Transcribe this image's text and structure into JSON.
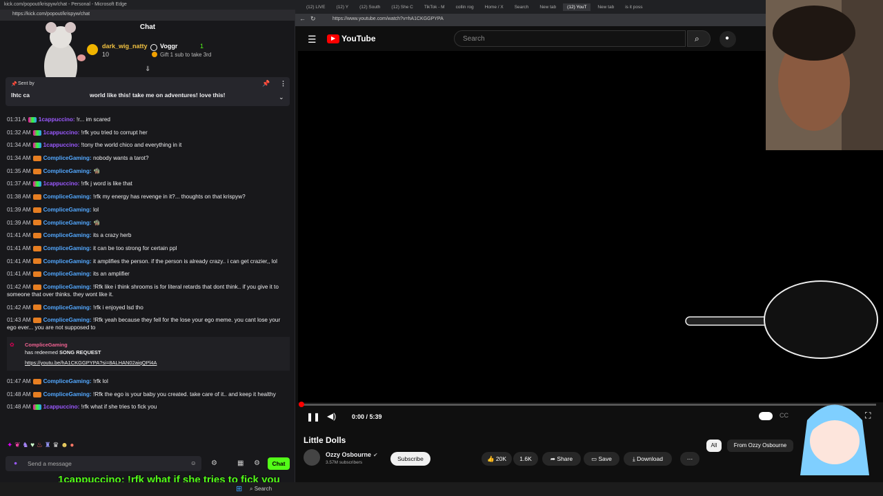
{
  "left_browser": {
    "title": "kick.com/popout/krispyw/chat - Personal - Microsoft Edge",
    "url": "https://kick.com/popout/krispyw/chat"
  },
  "chat": {
    "title": "Chat",
    "gifter": {
      "name": "dark_wig_natty",
      "count": "10",
      "badge_rank": "1"
    },
    "gift_user": {
      "name": "Voggr",
      "rank": "1",
      "text": "Gift 1 sub to take 3rd"
    },
    "pinned": {
      "label": "Sent by",
      "text_prefix": "lhtc ca",
      "text": "world like this! take me on adventures! love this!"
    },
    "messages": [
      {
        "time": "01:31 A",
        "user": "1cappuccino",
        "text": "!r... im scared",
        "style": "u1"
      },
      {
        "time": "01:32 AM",
        "user": "1cappuccino",
        "text": "!rfk you tried to corrupt her",
        "style": "u1"
      },
      {
        "time": "01:34 AM",
        "user": "1cappuccino",
        "text": "!tony the world chico and everything in it",
        "style": "u1"
      },
      {
        "time": "01:34 AM",
        "user": "CompliceGaming",
        "text": "nobody wants a tarot?",
        "style": "u2"
      },
      {
        "time": "01:35 AM",
        "user": "CompliceGaming",
        "text": "🧌",
        "style": "u2"
      },
      {
        "time": "01:37 AM",
        "user": "1cappuccino",
        "text": "!rfk j word is like that",
        "style": "u1"
      },
      {
        "time": "01:38 AM",
        "user": "CompliceGaming",
        "text": "!rfk my energy has revenge in it?... thoughts on that krispyw?",
        "style": "u2"
      },
      {
        "time": "01:39 AM",
        "user": "CompliceGaming",
        "text": "lol",
        "style": "u2"
      },
      {
        "time": "01:39 AM",
        "user": "CompliceGaming",
        "text": "🧌",
        "style": "u2"
      },
      {
        "time": "01:41 AM",
        "user": "CompliceGaming",
        "text": "its a crazy herb",
        "style": "u2"
      },
      {
        "time": "01:41 AM",
        "user": "CompliceGaming",
        "text": "it can be too strong for certain ppl",
        "style": "u2"
      },
      {
        "time": "01:41 AM",
        "user": "CompliceGaming",
        "text": "it amplifies the person. if the person is already crazy.. i can get crazier,, lol",
        "style": "u2"
      },
      {
        "time": "01:41 AM",
        "user": "CompliceGaming",
        "text": "its an amplifier",
        "style": "u2"
      },
      {
        "time": "01:42 AM",
        "user": "CompliceGaming",
        "text": "!Rfk like i think shrooms is for literal retards that dont think.. if you give it to someone that over thinks. they wont like it.",
        "style": "u2"
      },
      {
        "time": "01:42 AM",
        "user": "CompliceGaming",
        "text": "!rfk i enjoyed lsd tho",
        "style": "u2"
      },
      {
        "time": "01:43 AM",
        "user": "CompliceGaming",
        "text": "!Rfk yeah because they fell for the lose your ego meme. you cant lose your ego ever... you are not supposed to",
        "style": "u2"
      }
    ],
    "redeem": {
      "user": "CompliceGaming",
      "action": "has redeemed",
      "reward": "SONG REQUEST",
      "link": "https://youtu.be/hA1CKGGPYPA?si=8ALHAN02aiqQPl4A"
    },
    "messages_after": [
      {
        "time": "01:47 AM",
        "user": "CompliceGaming",
        "text": "!rfk lol",
        "style": "u2"
      },
      {
        "time": "01:48 AM",
        "user": "CompliceGaming",
        "text": "!Rfk the ego is your baby you created. take care of it.. and keep it healthy",
        "style": "u2"
      },
      {
        "time": "01:48 AM",
        "user": "1cappuccino",
        "text": "!rfk what if she tries to fick you",
        "style": "u1"
      }
    ],
    "input_placeholder": "Send a message",
    "send_label": "Chat"
  },
  "overlay_caption": "1cappuccino: !rfk what if she tries to fick you",
  "right_browser": {
    "tabs": [
      "(12) LIVE",
      "(12) Y",
      "(12) South",
      "(12) She C",
      "TikTok - M",
      "collin rog",
      "Home / X",
      "Search",
      "New tab",
      "(12) YouT",
      "New tab",
      "is it poss"
    ],
    "url": "https://www.youtube.com/watch?v=hA1CKGGPYPA"
  },
  "youtube": {
    "logo": "YouTube",
    "search_placeholder": "Search",
    "time": "0:00 / 5:39",
    "progress": 0.003,
    "video_title": "Little Dolls",
    "channel": "Ozzy Osbourne",
    "subscribers": "3.57M subscribers",
    "subscribe_label": "Subscribe",
    "likes": "20K",
    "dislikes_or_comments": "1.6K",
    "share": "Share",
    "save": "Save",
    "download": "Download",
    "chips": [
      "All",
      "From Ozzy Osbourne"
    ]
  },
  "colors": {
    "kick_green": "#53fc18",
    "yt_red": "#ff0000",
    "user_purple": "#9b59ff",
    "user_blue": "#53a8ff"
  }
}
